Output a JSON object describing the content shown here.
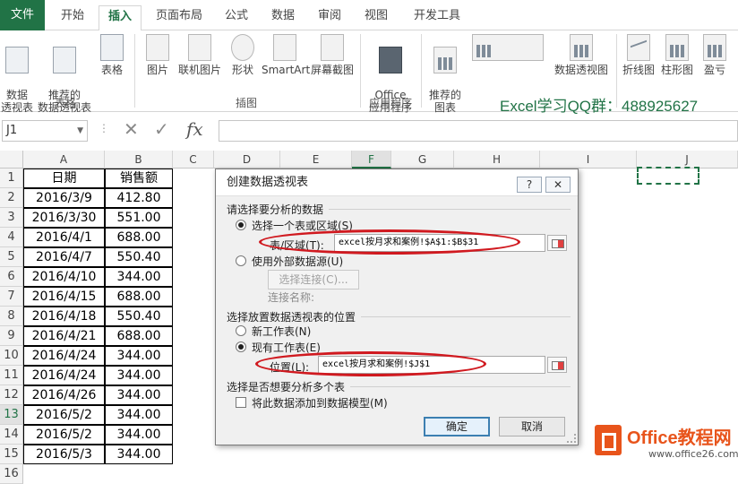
{
  "ribbon": {
    "tabs": [
      "文件",
      "开始",
      "插入",
      "页面布局",
      "公式",
      "数据",
      "审阅",
      "视图",
      "开发工具"
    ],
    "active_tab": "插入",
    "buttons": {
      "pivot": "数据\n透视表",
      "recommended_pivot": "推荐的\n数据透视表",
      "table": "表格",
      "picture": "图片",
      "online_picture": "联机图片",
      "shapes": "形状",
      "smartart": "SmartArt",
      "screenshot": "屏幕截图",
      "office_apps": "Office\n应用程序",
      "recommended_charts": "推荐的\n图表",
      "pivot_chart": "数据透视图",
      "line": "折线图",
      "column": "柱形图",
      "winloss": "盈亏"
    },
    "groups": {
      "tables": "表格",
      "illustrations": "插图",
      "apps": "应用程序"
    },
    "banner": "Excel学习QQ群：488925627"
  },
  "formula_bar": {
    "name_box": "J1",
    "fx": "fx",
    "value": ""
  },
  "sheet": {
    "columns": [
      "A",
      "B",
      "C",
      "D",
      "E",
      "F",
      "G",
      "H",
      "I",
      "J"
    ],
    "selected_column": "F",
    "rows": [
      "1",
      "2",
      "3",
      "4",
      "5",
      "6",
      "7",
      "8",
      "9",
      "10",
      "11",
      "12",
      "13",
      "14",
      "15",
      "16"
    ],
    "selected_row": "13",
    "header": {
      "a": "日期",
      "b": "销售额"
    },
    "data": [
      {
        "a": "2016/3/9",
        "b": "412.80"
      },
      {
        "a": "2016/3/30",
        "b": "551.00"
      },
      {
        "a": "2016/4/1",
        "b": "688.00"
      },
      {
        "a": "2016/4/7",
        "b": "550.40"
      },
      {
        "a": "2016/4/10",
        "b": "344.00"
      },
      {
        "a": "2016/4/15",
        "b": "688.00"
      },
      {
        "a": "2016/4/18",
        "b": "550.40"
      },
      {
        "a": "2016/4/21",
        "b": "688.00"
      },
      {
        "a": "2016/4/24",
        "b": "344.00"
      },
      {
        "a": "2016/4/24",
        "b": "344.00"
      },
      {
        "a": "2016/4/26",
        "b": "344.00"
      },
      {
        "a": "2016/5/2",
        "b": "344.00"
      },
      {
        "a": "2016/5/2",
        "b": "344.00"
      },
      {
        "a": "2016/5/3",
        "b": "344.00"
      }
    ]
  },
  "dialog": {
    "title": "创建数据透视表",
    "help": "?",
    "close": "✕",
    "section_data": "请选择要分析的数据",
    "opt_select_range": "选择一个表或区域(S)",
    "label_range": "表/区域(T):",
    "range_value": "excel按月求和案例!$A$1:$B$31",
    "opt_external": "使用外部数据源(U)",
    "btn_choose_conn": "选择连接(C)...",
    "label_conn_name": "连接名称:",
    "section_location": "选择放置数据透视表的位置",
    "opt_new_sheet": "新工作表(N)",
    "opt_existing_sheet": "现有工作表(E)",
    "label_location": "位置(L):",
    "location_value": "excel按月求和案例!$J$1",
    "section_multi": "选择是否想要分析多个表",
    "chk_data_model": "将此数据添加到数据模型(M)",
    "btn_ok": "确定",
    "btn_cancel": "取消"
  },
  "watermark": {
    "brand": "Office教程网",
    "url": "www.office26.com"
  },
  "colors": {
    "excel_green": "#217346",
    "highlight_red": "#d0191f",
    "logo_orange": "#e8541b"
  }
}
